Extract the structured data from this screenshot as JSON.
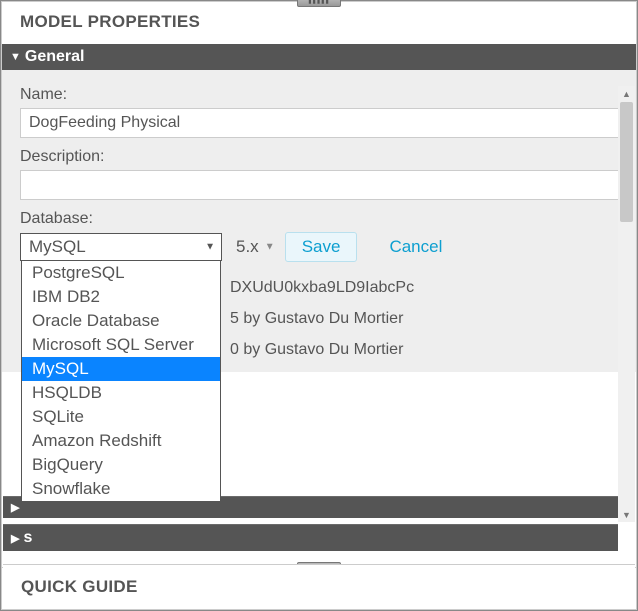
{
  "panel_title": "MODEL PROPERTIES",
  "sections": {
    "general": {
      "title": "General",
      "name_label": "Name:",
      "name_value": "DogFeeding Physical",
      "description_label": "Description:",
      "description_value": "",
      "database_label": "Database:",
      "database_selected": "MySQL",
      "database_options": [
        "PostgreSQL",
        "IBM DB2",
        "Oracle Database",
        "Microsoft SQL Server",
        "MySQL",
        "HSQLDB",
        "SQLite",
        "Amazon Redshift",
        "BigQuery",
        "Snowflake"
      ],
      "version_selected": "5.x",
      "save_label": "Save",
      "cancel_label": "Cancel",
      "info_id": "DXUdU0kxba9LD9IabcPc",
      "info_created": "5 by Gustavo Du Mortier",
      "info_lastmod": "0 by Gustavo Du Mortier"
    },
    "collapsed1_title": "",
    "collapsed2_title": "s"
  },
  "quick_guide_title": "QUICK GUIDE"
}
